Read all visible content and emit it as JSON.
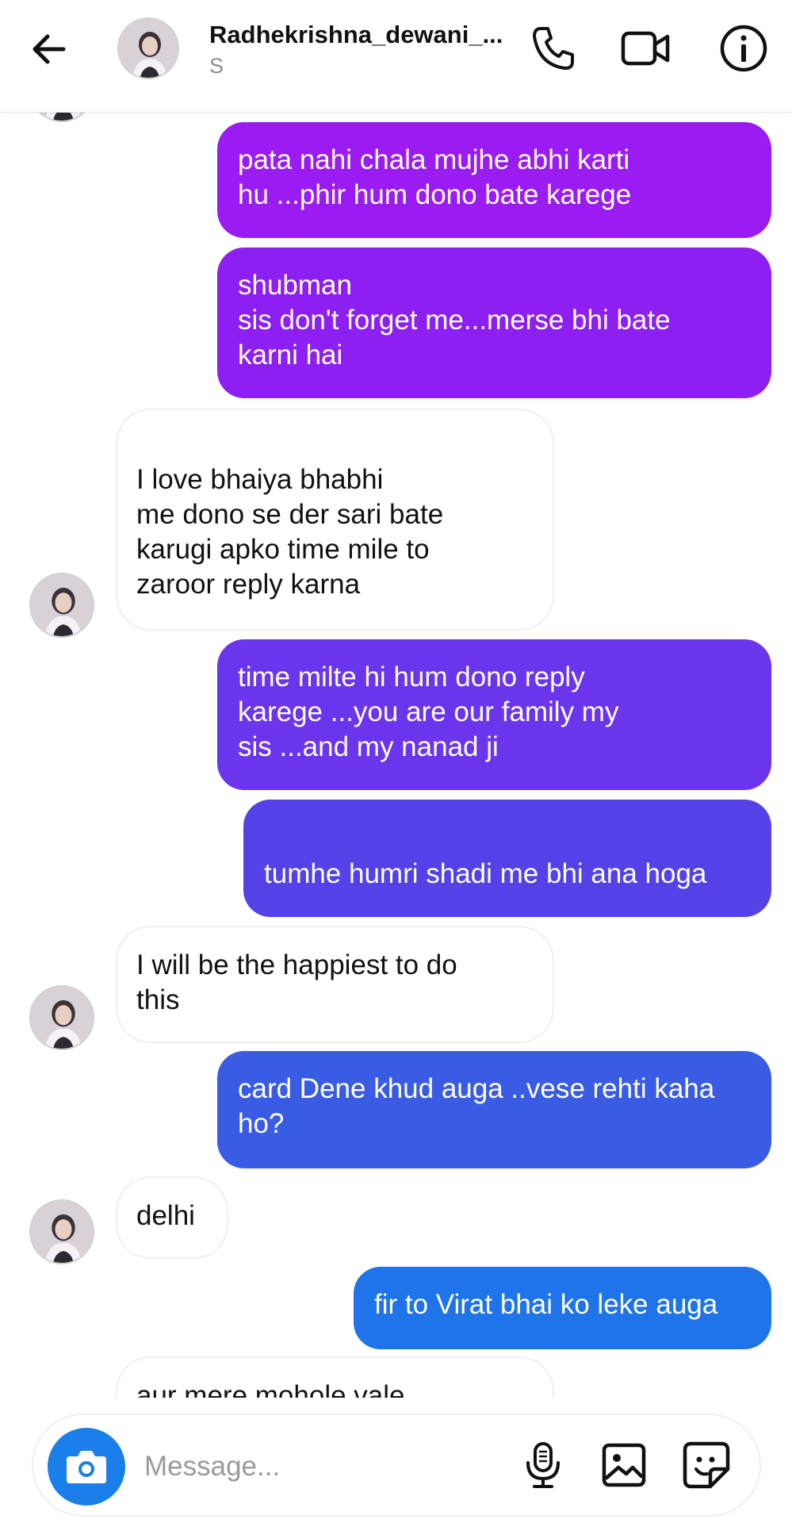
{
  "header": {
    "title": "Radhekrishna_dewani_...",
    "subtitle": "S",
    "icons": [
      "back-arrow-icon",
      "phone-icon",
      "video-icon",
      "info-icon"
    ]
  },
  "messages": [
    {
      "side": "out",
      "text": "pata nahi chala mujhe abhi karti\nhu ...phir hum dono bate karege",
      "color": "#9a1cf2"
    },
    {
      "side": "out",
      "text": "shubman\nsis don't forget me...merse bhi bate\nkarni hai",
      "color": "#8e1ff2"
    },
    {
      "side": "in",
      "text": "I love bhaiya bhabhi\nme dono se der sari bate\nkarugi apko time mile to\nzaroor reply karna"
    },
    {
      "side": "out",
      "text": "time milte hi hum dono reply\nkarege ...you are our family my\nsis ...and my nanad ji",
      "color": "#6b35ee"
    },
    {
      "side": "out",
      "text": "tumhe humri shadi me bhi ana hoga",
      "color": "#5441e8"
    },
    {
      "side": "in",
      "text": "I will be the happiest to do\nthis"
    },
    {
      "side": "out",
      "text": "card Dene khud auga ..vese rehti kaha\nho?",
      "color": "#3a5ce4"
    },
    {
      "side": "in",
      "text": "delhi"
    },
    {
      "side": "out",
      "text": "fir to Virat bhai ko leke auga",
      "color": "#1e74e8"
    },
    {
      "side": "in",
      "text": "aur mere mohole vale"
    }
  ],
  "composer": {
    "placeholder": "Message...",
    "icons": [
      "camera-icon",
      "microphone-icon",
      "gallery-icon",
      "sticker-icon"
    ]
  },
  "colors": {
    "accent": "#1a7fe8",
    "incoming_border": "#efefef"
  }
}
